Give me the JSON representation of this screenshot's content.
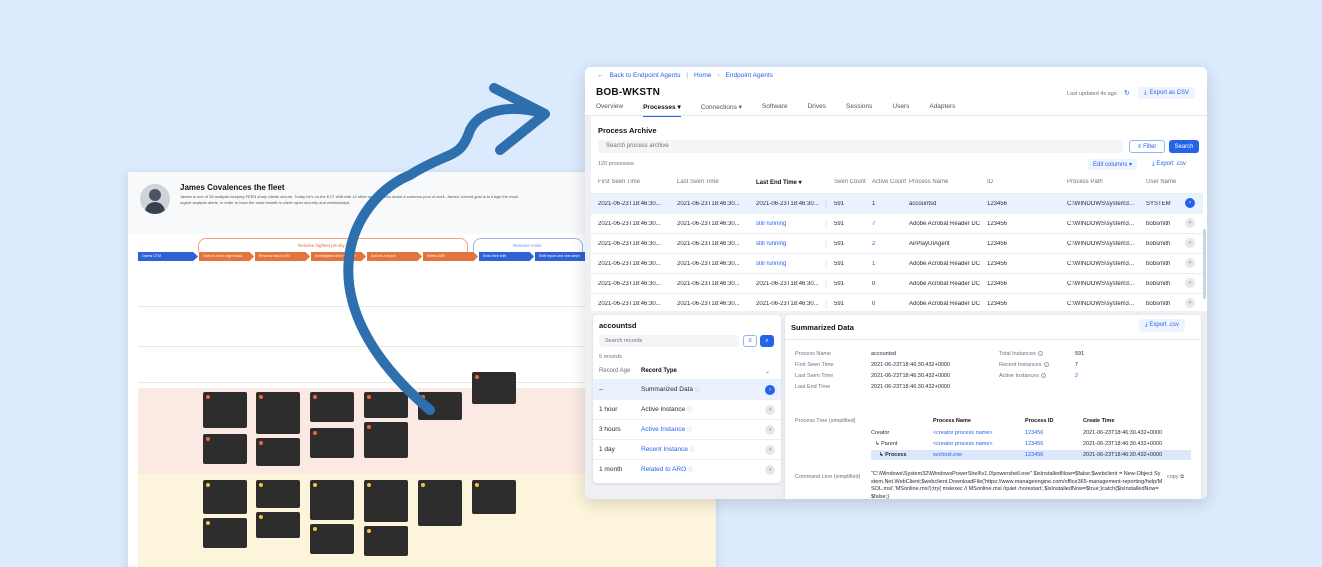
{
  "board": {
    "title": "James Covalences the fleet",
    "description": "James is one of 38 analysts keeping FEEN shaly clients secure. Today he's on the EXT shift with 10 other analysts who share a common pool of work. James' current goal is to triage the most urgent analysis alerts, in order to have the most benefit to client cyber security and relationships.",
    "phase_primary": "Resolve highest priority tasks",
    "phase_secondary": "Remove noise",
    "stages": [
      "Opens CTM",
      "Goes to most urgent task",
      "Reviews task in EM",
      "Investigates client timeline",
      "Actions a report",
      "Writes AAR",
      "Ends their shift",
      "Shift report and next steps"
    ],
    "accent_colors": {
      "phase": "#e46d33",
      "phase_secondary": "#6d8ff0",
      "stage_blue": "#2f62d6",
      "stage_orange": "#e3743e"
    }
  },
  "app": {
    "back_link": "Back to Endpoint Agents",
    "breadcrumb": [
      "Home",
      "Endpoint Agents"
    ],
    "title": "BOB-WKSTN",
    "last_updated": "Last updated 4s ago",
    "export_label": "Export as CSV",
    "tabs": [
      "Overview",
      "Processes",
      "Connections",
      "Software",
      "Drives",
      "Sessions",
      "Users",
      "Adapters"
    ],
    "active_tab": "Processes"
  },
  "archive": {
    "title": "Process Archive",
    "search_placeholder": "Search process archive",
    "filter_label": "Filter",
    "search_label": "Search",
    "count": "120 processes",
    "edit_columns": "Edit columns",
    "export": "Export .csv",
    "columns": [
      "First Seen Time",
      "Last Seen Time",
      "Last End Time",
      "Seen Count",
      "Active Count",
      "Process Name",
      "ID",
      "Process Path",
      "User Name"
    ],
    "rows": [
      {
        "first": "2021-06-23T18:46:30...",
        "last": "2021-06-23T18:46:30...",
        "end": "2021-06-23T18:46:30...",
        "seen": "591",
        "active": "1",
        "name": "accountsd",
        "id": "123456",
        "path": "C:\\WINDOWS\\system3...",
        "user": "SYSTEM",
        "selected": true
      },
      {
        "first": "2021-06-23T18:46:30...",
        "last": "2021-06-23T18:46:30...",
        "end": "still running",
        "seen": "591",
        "active": "7",
        "name": "Adobe Acrobat Reader DC",
        "id": "123456",
        "path": "C:\\WINDOWS\\system3...",
        "user": "bobsmith"
      },
      {
        "first": "2021-06-23T18:46:30...",
        "last": "2021-06-23T18:46:30...",
        "end": "still running",
        "seen": "591",
        "active": "2",
        "name": "AirPlayUIAgent",
        "id": "123456",
        "path": "C:\\WINDOWS\\system3...",
        "user": "bobsmith"
      },
      {
        "first": "2021-06-23T18:46:30...",
        "last": "2021-06-23T18:46:30...",
        "end": "still running",
        "seen": "591",
        "active": "1",
        "name": "Adobe Acrobat Reader DC",
        "id": "123456",
        "path": "C:\\WINDOWS\\system3...",
        "user": "bobsmith"
      },
      {
        "first": "2021-06-23T18:46:30...",
        "last": "2021-06-23T18:46:30...",
        "end": "2021-06-23T18:46:30...",
        "seen": "591",
        "active": "0",
        "name": "Adobe Acrobat Reader DC",
        "id": "123456",
        "path": "C:\\WINDOWS\\system3...",
        "user": "bobsmith"
      },
      {
        "first": "2021-06-23T18:46:30...",
        "last": "2021-06-23T18:46:30...",
        "end": "2021-06-23T18:46:30...",
        "seen": "591",
        "active": "0",
        "name": "Adobe Acrobat Reader DC",
        "id": "123456",
        "path": "C:\\WINDOWS\\system3...",
        "user": "bobsmith"
      }
    ]
  },
  "records": {
    "title": "accountsd",
    "search_placeholder": "Search records",
    "count": "5 records",
    "col_age": "Record Age",
    "col_type": "Record Type",
    "rows": [
      {
        "age": "--",
        "type": "Summarized Data",
        "link": false,
        "selected": true
      },
      {
        "age": "1 hour",
        "type": "Active Instance",
        "link": false
      },
      {
        "age": "3 hours",
        "type": "Active Instance",
        "link": true
      },
      {
        "age": "1 day",
        "type": "Recent Instance",
        "link": true
      },
      {
        "age": "1 month",
        "type": "Related to ARO",
        "link": true
      }
    ]
  },
  "summary": {
    "title": "Summarized Data",
    "export": "Export .csv",
    "process_name_label": "Process Name",
    "process_name": "accountsd",
    "first_seen_label": "First Seen Time",
    "first_seen": "2021-06-23T18:46:30.432+0000",
    "last_seen_label": "Last Seen Time",
    "last_seen": "2021-06-23T18:46:30.432+0000",
    "last_end_label": "Last End Time",
    "last_end": "2021-06-23T18:46:30.432+0000",
    "total_instances_label": "Total Instances",
    "total_instances": "591",
    "recent_instances_label": "Recent Instances",
    "recent_instances": "7",
    "active_instances_label": "Active Instances",
    "active_instances": "2",
    "tree_label": "Process Tree (simplified)",
    "tree_headers": [
      "Process Name",
      "Process ID",
      "Create Time"
    ],
    "tree_rows": [
      {
        "role": "Creator",
        "name": "<creator process name>",
        "id": "123456",
        "time": "2021-06-23T18:46:30.432+0000"
      },
      {
        "role": "Parent",
        "name": "<creator process name>",
        "id": "123456",
        "time": "2021-06-23T18:46:30.432+0000"
      },
      {
        "role": "Process",
        "name": "svchost.exe",
        "id": "123456",
        "time": "2021-06-23T18:46:30.432+0000"
      }
    ],
    "cmd_label": "Command Line (simplified)",
    "cmd": "\"C:\\Windows\\System32\\WindowsPowerShell\\v1.0\\powershell.exe\" $isInstalledNow=$false;$webclient = New-Object System.Net.WebClient;$webclient.DownloadFile('https://www.manageengine.com/office365-management-reporting/help/MSOL.msi','MSonline.msi');try{ msiexec /i MSonline.msi /quiet /norestart; $isInstalledNow=$true;}catch{$isInstalledNow=$false;}",
    "copy": "copy"
  }
}
